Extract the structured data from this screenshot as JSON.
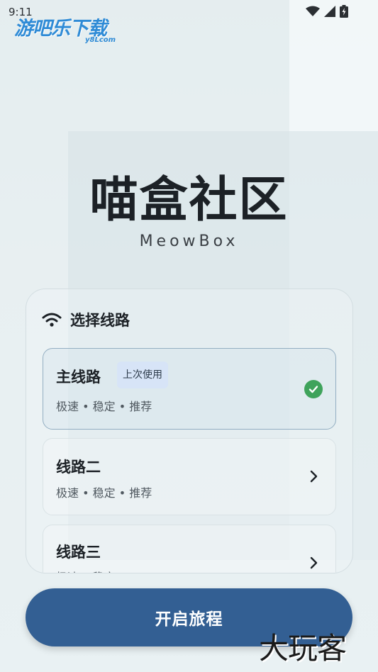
{
  "status_bar": {
    "time": "9:11",
    "icons": [
      "wifi-icon",
      "cellular-signal-icon",
      "battery-charging-icon"
    ]
  },
  "watermark_top": {
    "title": "游吧乐下载",
    "subtitle": "y8Lcom"
  },
  "app": {
    "title": "喵盒社区",
    "subtitle": "MeowBox"
  },
  "line_selector": {
    "header_icon": "wifi-icon",
    "title": "选择线路",
    "routes": [
      {
        "name": "主线路",
        "badge": "上次使用",
        "desc": "极速 • 稳定 • 推荐",
        "state": "selected",
        "icon": "check-circle-icon"
      },
      {
        "name": "线路二",
        "desc": "极速 • 稳定 • 推荐",
        "icon": "chevron-right-icon"
      },
      {
        "name": "线路三",
        "desc": "极速 • 稳定",
        "icon": "chevron-right-icon"
      }
    ]
  },
  "start_button": {
    "label": "开启旅程"
  },
  "watermark_bottom": {
    "text": "大玩客"
  },
  "colors": {
    "primary": "#335f93",
    "success": "#3fa35b",
    "badge_bg": "#d7e4f7"
  }
}
